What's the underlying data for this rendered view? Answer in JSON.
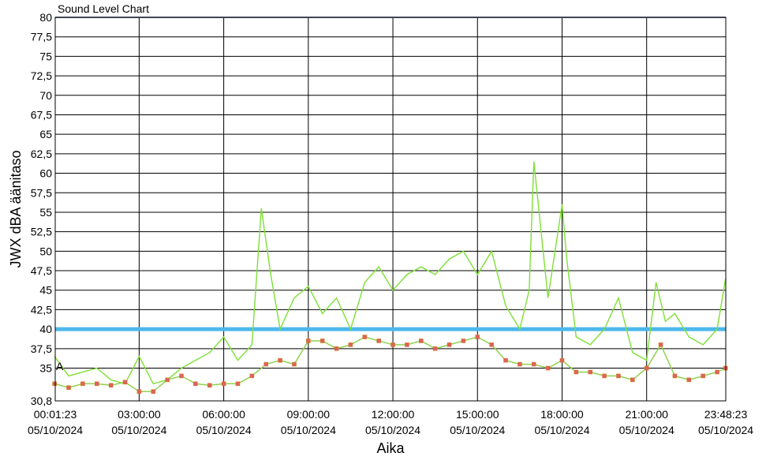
{
  "chart_data": {
    "type": "line",
    "title": "Sound Level Chart",
    "xlabel": "Aika",
    "ylabel": "JWX dBA äänitaso",
    "ylim": [
      30.8,
      80
    ],
    "xlim": [
      "00:01:23",
      "23:48:23"
    ],
    "ytick_labels": [
      "80",
      "77,5",
      "75",
      "72,5",
      "70",
      "67,5",
      "65",
      "62,5",
      "60",
      "57,5",
      "55",
      "52,5",
      "50",
      "47,5",
      "45",
      "42,5",
      "40",
      "37,5",
      "35",
      "30,8"
    ],
    "ytick_values": [
      80,
      77.5,
      75,
      72.5,
      70,
      67.5,
      65,
      62.5,
      60,
      57.5,
      55,
      52.5,
      50,
      47.5,
      45,
      42.5,
      40,
      37.5,
      35,
      30.8
    ],
    "xticks": [
      {
        "time": "00:01:23",
        "date": "05/10/2024"
      },
      {
        "time": "03:00:00",
        "date": "05/10/2024"
      },
      {
        "time": "06:00:00",
        "date": "05/10/2024"
      },
      {
        "time": "09:00:00",
        "date": "05/10/2024"
      },
      {
        "time": "12:00:00",
        "date": "05/10/2024"
      },
      {
        "time": "15:00:00",
        "date": "05/10/2024"
      },
      {
        "time": "18:00:00",
        "date": "05/10/2024"
      },
      {
        "time": "21:00:00",
        "date": "05/10/2024"
      },
      {
        "time": "23:48:23",
        "date": "05/10/2024"
      }
    ],
    "threshold": {
      "value": 40,
      "color": "#4db8ec"
    },
    "marker_label": "A",
    "grid": true,
    "series": [
      {
        "kind": "max_line",
        "color": "#7ee035",
        "x": [
          "00:00",
          "00:30",
          "01:00",
          "01:30",
          "02:00",
          "02:30",
          "03:00",
          "03:30",
          "04:00",
          "04:30",
          "05:00",
          "05:30",
          "06:00",
          "06:30",
          "07:00",
          "07:20",
          "07:40",
          "08:00",
          "08:30",
          "09:00",
          "09:30",
          "10:00",
          "10:30",
          "11:00",
          "11:30",
          "12:00",
          "12:30",
          "13:00",
          "13:30",
          "14:00",
          "14:30",
          "15:00",
          "15:30",
          "16:00",
          "16:30",
          "16:50",
          "17:00",
          "17:30",
          "18:00",
          "18:10",
          "18:30",
          "19:00",
          "19:30",
          "20:00",
          "20:30",
          "21:00",
          "21:20",
          "21:40",
          "22:00",
          "22:30",
          "23:00",
          "23:30",
          "23:48"
        ],
        "values": [
          36.5,
          34,
          34.5,
          35,
          33.5,
          33,
          36.5,
          33,
          33.5,
          35,
          36,
          37,
          39,
          36,
          38,
          55.5,
          47,
          40,
          44,
          45.5,
          42,
          44,
          40,
          46,
          48,
          45,
          47,
          48,
          47,
          49,
          50,
          47,
          50,
          43,
          40,
          45,
          61.5,
          44,
          56,
          49,
          39,
          38,
          40,
          44,
          37,
          36,
          46,
          41,
          42,
          39,
          38,
          40,
          46.5
        ]
      },
      {
        "kind": "avg_points",
        "color": "#e06060",
        "x": [
          "00:00",
          "00:30",
          "01:00",
          "01:30",
          "02:00",
          "02:30",
          "03:00",
          "03:30",
          "04:00",
          "04:30",
          "05:00",
          "05:30",
          "06:00",
          "06:30",
          "07:00",
          "07:30",
          "08:00",
          "08:30",
          "09:00",
          "09:30",
          "10:00",
          "10:30",
          "11:00",
          "11:30",
          "12:00",
          "12:30",
          "13:00",
          "13:30",
          "14:00",
          "14:30",
          "15:00",
          "15:30",
          "16:00",
          "16:30",
          "17:00",
          "17:30",
          "18:00",
          "18:30",
          "19:00",
          "19:30",
          "20:00",
          "20:30",
          "21:00",
          "21:30",
          "22:00",
          "22:30",
          "23:00",
          "23:30",
          "23:48"
        ],
        "values": [
          33,
          32.5,
          33,
          33,
          32.8,
          33.2,
          32,
          32,
          33.5,
          34,
          33,
          32.8,
          33,
          33,
          34,
          35.5,
          36,
          35.5,
          38.5,
          38.5,
          37.5,
          38,
          39,
          38.5,
          38,
          38,
          38.5,
          37.5,
          38,
          38.5,
          39,
          38,
          36,
          35.5,
          35.5,
          35,
          36,
          34.5,
          34.5,
          34,
          34,
          33.5,
          35,
          38,
          34,
          33.5,
          34,
          34.5,
          35
        ]
      }
    ]
  }
}
